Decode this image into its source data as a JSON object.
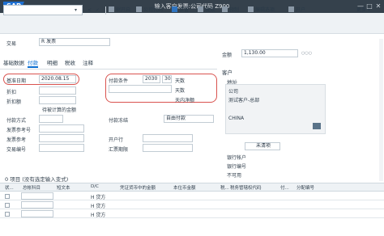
{
  "header": {
    "logo": "SAP",
    "title": "输入客户发票:公司代码 Z900",
    "win_min": "—",
    "win_max": "□",
    "win_close": "✕"
  },
  "toolbar": {
    "back": "<",
    "ok": "✓",
    "items": [
      "树开启",
      "公司代码",
      "保留",
      "模拟",
      "预制",
      "编辑选项",
      "开户"
    ],
    "more": "更多",
    "more_arrow": "▾",
    "cmd_arrow": "▾"
  },
  "form": {
    "txn_label": "交易",
    "txn_value": "R 发票",
    "amount_label": "金额",
    "amount_value": "1,130.00",
    "tabs": [
      "基础数据",
      "付款",
      "明细",
      "税收",
      "注释"
    ],
    "baseline_label": "基准日期",
    "baseline_value": "2020.08.15",
    "discount_label": "折扣",
    "discount_amt_label": "折扣额",
    "invoice_ref_label": "发票参考",
    "pay_terms_label": "付款条件",
    "pay_terms_value": "2030",
    "days_value": "30",
    "days1": "天数",
    "days2": "天数",
    "net_days": "天内净额",
    "fixed_label": "固定",
    "pay_curr_label": "待被计算的金额",
    "pay_method_label": "付款方式",
    "pay_block_label": "付款冻结",
    "pay_block_value": "自由付款",
    "invoice_ref2_label": "发票参考号",
    "open_bank_label": "开户行",
    "house_bank_label": "自有银行",
    "trade_label": "交易编号",
    "fx_label": "汇票期限"
  },
  "customer": {
    "title": "客户",
    "address_label": "地址",
    "company_label": "公司",
    "company_value": "测试客户-总部",
    "country_value": "CHINA",
    "not_clear_label": "未清项",
    "bank_account": "银行帐户",
    "bank_no": "银行编号",
    "iban": "银行编号",
    "status": "不可用"
  },
  "items_section": {
    "title": "0 项目 (没有选定输入变式)",
    "cols": [
      "状...",
      "总帐科目",
      "短文本",
      "D/C",
      "凭证货币中的金额",
      "本位币金额",
      "税...",
      "税务管辖权代码",
      "付...",
      "分配编号"
    ],
    "rows": [
      {
        "dc": "H 贷方"
      },
      {
        "dc": "H 贷方"
      },
      {
        "dc": "H 贷方"
      }
    ]
  }
}
